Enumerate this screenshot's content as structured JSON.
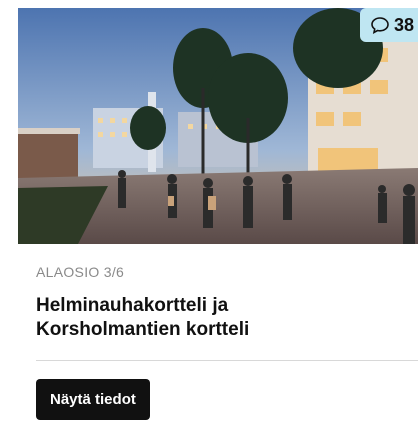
{
  "card": {
    "comment_count": "38",
    "comment_icon": "speech-bubble-icon",
    "subtitle": "ALAOSIO 3/6",
    "title_line1": "Helminauhakortteli ja",
    "title_line2": "Korsholmantien kortteli",
    "button_label": "Näytä tiedot"
  },
  "colors": {
    "badge_bg": "#bfe6f2",
    "button_bg": "#111111",
    "subtitle": "#8a8a8a"
  }
}
